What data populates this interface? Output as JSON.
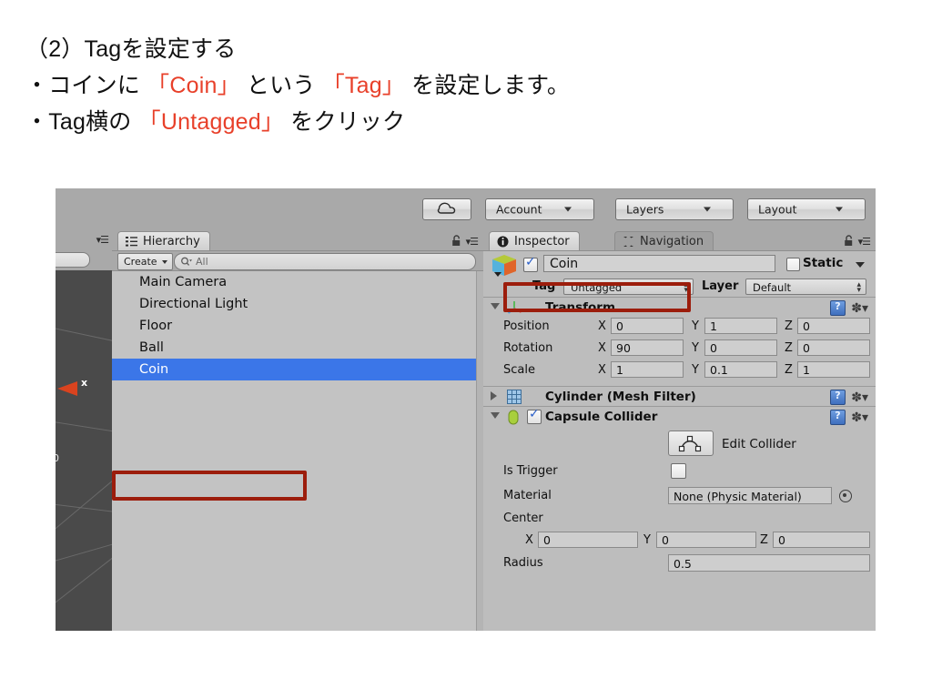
{
  "headings": [
    {
      "segments": [
        {
          "text": "（2）Tagを設定する",
          "color": "black"
        }
      ]
    },
    {
      "segments": [
        {
          "text": "・コインに ",
          "color": "black"
        },
        {
          "text": "「Coin」",
          "color": "red"
        },
        {
          "text": " という ",
          "color": "black"
        },
        {
          "text": "「Tag」",
          "color": "red"
        },
        {
          "text": " を設定します。",
          "color": "black"
        }
      ]
    },
    {
      "segments": [
        {
          "text": "・Tag横の ",
          "color": "black"
        },
        {
          "text": "「Untagged」",
          "color": "red"
        },
        {
          "text": " をクリック",
          "color": "black"
        }
      ]
    }
  ],
  "colors": {
    "highlight_red": "#e8402a",
    "annotation_box": "#9c1d0c",
    "selection_blue": "#3b76e8",
    "panel_gray": "#bdbdbd",
    "toolbar_gray": "#a9a9a9",
    "scene_dark": "#4a4a4a",
    "axis_orange": "#d9431f"
  },
  "toolbar": {
    "cloud_button": "cloud-icon",
    "account_label": "Account",
    "layers_label": "Layers",
    "layout_label": "Layout"
  },
  "scene_view": {
    "axis_x_label": "x",
    "axis_origin_label": "0"
  },
  "hierarchy": {
    "tab_label": "Hierarchy",
    "create_label": "Create",
    "search_value": "All",
    "items": [
      {
        "label": "Main Camera",
        "selected": false
      },
      {
        "label": "Directional Light",
        "selected": false
      },
      {
        "label": "Floor",
        "selected": false
      },
      {
        "label": "Ball",
        "selected": false
      },
      {
        "label": "Coin",
        "selected": true
      }
    ]
  },
  "inspector": {
    "tab_label": "Inspector",
    "navigation_tab_label": "Navigation",
    "object": {
      "enabled_checkbox": true,
      "name": "Coin",
      "static_label": "Static",
      "static_checked": false
    },
    "tag_row": {
      "tag_label": "Tag",
      "tag_value": "Untagged",
      "layer_label": "Layer",
      "layer_value": "Default"
    },
    "transform": {
      "title": "Transform",
      "expanded": true,
      "rows": [
        {
          "label": "Position",
          "x": "0",
          "y": "1",
          "z": "0"
        },
        {
          "label": "Rotation",
          "x": "90",
          "y": "0",
          "z": "0"
        },
        {
          "label": "Scale",
          "x": "1",
          "y": "0.1",
          "z": "1"
        }
      ],
      "axis_labels": {
        "x": "X",
        "y": "Y",
        "z": "Z"
      }
    },
    "mesh_filter": {
      "title": "Cylinder (Mesh Filter)",
      "expanded": false
    },
    "capsule_collider": {
      "title": "Capsule Collider",
      "expanded": true,
      "enabled_checkbox": true,
      "edit_collider_label": "Edit Collider",
      "is_trigger_label": "Is Trigger",
      "is_trigger_checked": false,
      "material_label": "Material",
      "material_value": "None (Physic Material)",
      "center_label": "Center",
      "center": {
        "x": "0",
        "y": "0",
        "z": "0"
      },
      "center_axis_labels": {
        "x": "X",
        "y": "Y",
        "z": "Z"
      },
      "radius_label": "Radius",
      "radius_value": "0.5"
    }
  }
}
